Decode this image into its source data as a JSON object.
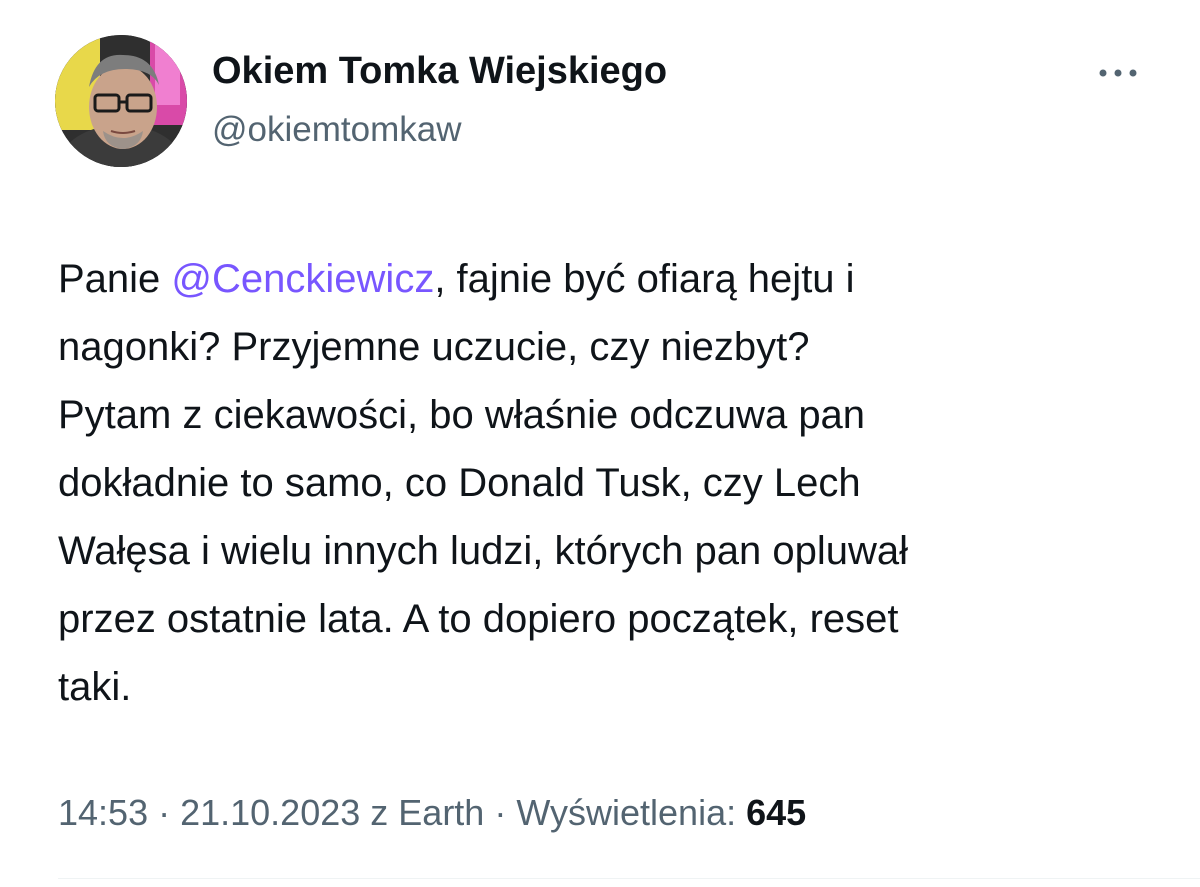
{
  "author": {
    "name": "Okiem Tomka Wiejskiego",
    "handle": "@okiemtomkaw",
    "avatar_icon": "profile-photo-avatar"
  },
  "more_icon": "more-horizontal-icon",
  "tweet": {
    "line1_before": "Panie ",
    "mention": "@Cenckiewicz",
    "line1_after": ", fajnie być ofiarą hejtu i",
    "line2": "nagonki? Przyjemne uczucie, czy niezbyt?",
    "line3": "Pytam z ciekawości, bo właśnie odczuwa pan",
    "line4": "dokładnie to samo, co Donald Tusk, czy Lech",
    "line5": "Wałęsa i wielu innych ludzi, których pan opluwał",
    "line6": "przez ostatnie lata. A to dopiero początek, reset",
    "line7": "taki."
  },
  "meta": {
    "time": "14:53",
    "sep1": " · ",
    "date": "21.10.2023",
    "source": " z Earth",
    "sep2": " · ",
    "views_label": "Wyświetlenia: ",
    "views_count": "645"
  },
  "colors": {
    "mention": "#7856ff",
    "secondary_text": "#536471",
    "primary_text": "#0f1419"
  }
}
